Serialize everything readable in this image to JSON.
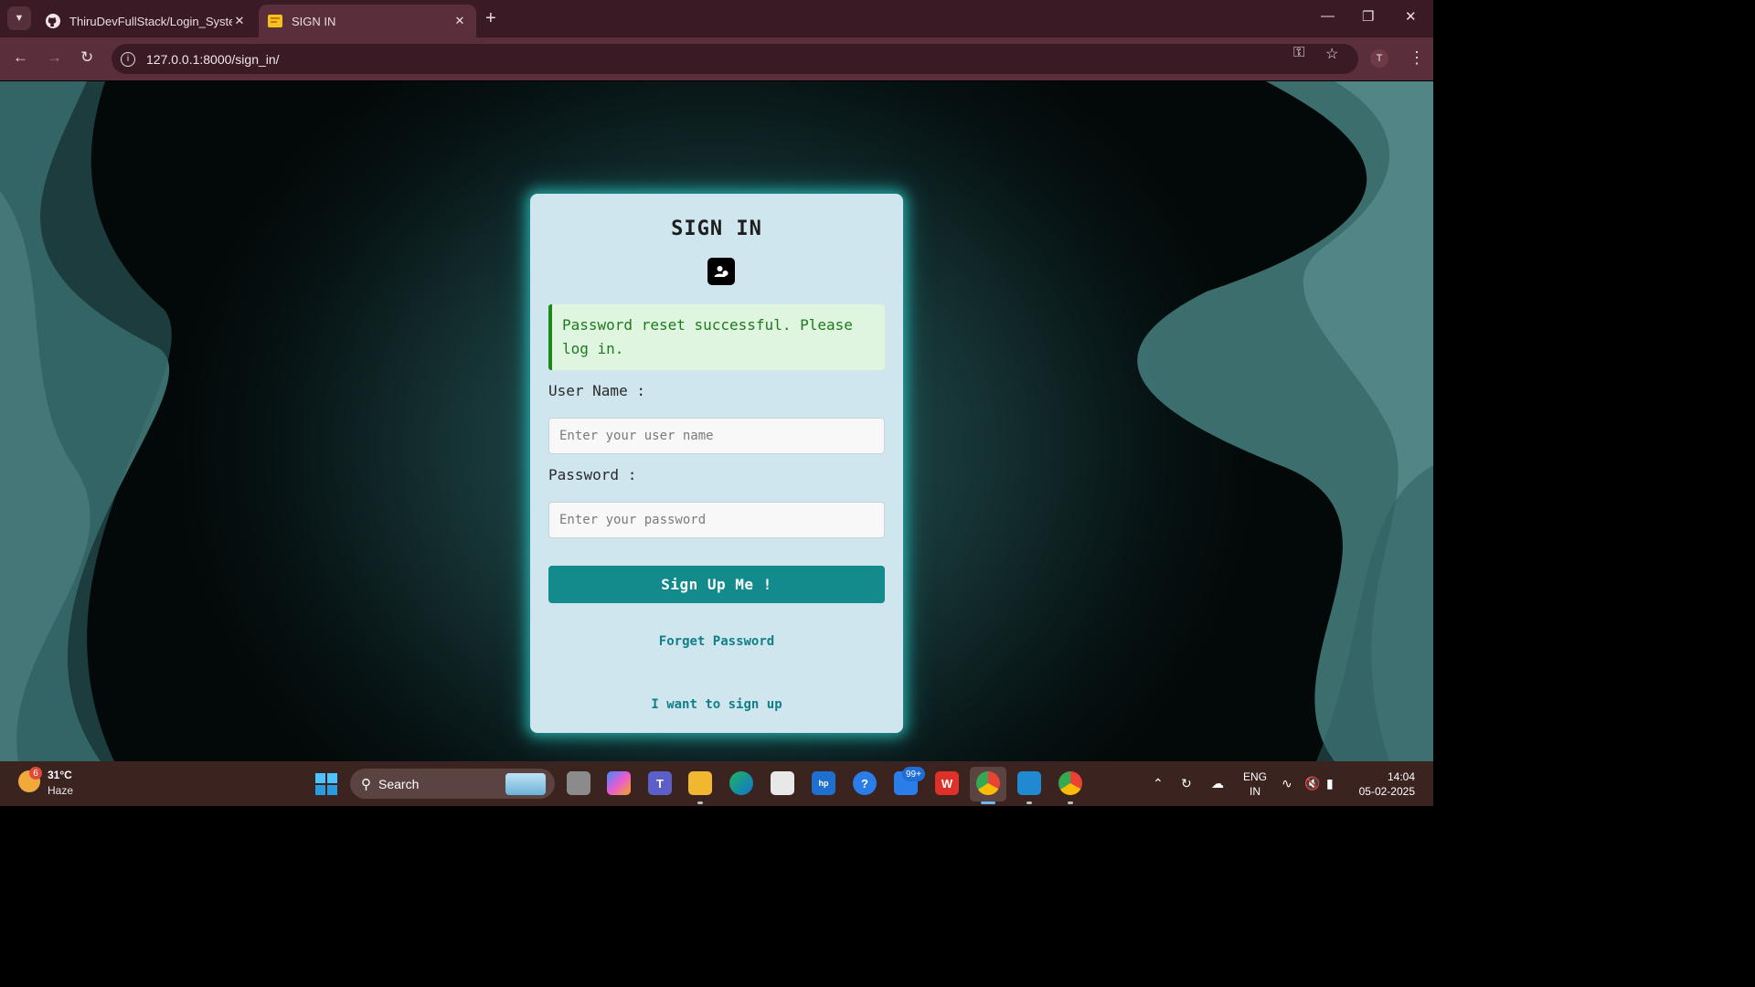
{
  "browser": {
    "tabs": [
      {
        "title": "ThiruDevFullStack/Login_System",
        "icon": "github-icon",
        "active": false
      },
      {
        "title": "SIGN IN",
        "icon": "site-favicon",
        "active": true
      }
    ],
    "url": "127.0.0.1:8000/sign_in/",
    "profile_initial": "T"
  },
  "page": {
    "title": "SIGN IN",
    "icon": "user-contact-icon",
    "alert": {
      "text": "Password reset successful. Please log in.",
      "type": "success",
      "color": "#1e7a1e"
    },
    "username": {
      "label": "User Name :",
      "placeholder": "Enter your user name",
      "value": ""
    },
    "password": {
      "label": "Password :",
      "placeholder": "Enter your password",
      "value": ""
    },
    "submit_label": "Sign Up Me !",
    "forgot_link": "Forget Password",
    "signup_link": "I want to sign up",
    "accent_color": "#138a8c"
  },
  "taskbar": {
    "weather": {
      "temp": "31°C",
      "condition": "Haze",
      "badge": "6"
    },
    "search_label": "Search",
    "notification_badge": "99+",
    "language": {
      "line1": "ENG",
      "line2": "IN"
    },
    "time": "14:04",
    "date": "05-02-2025"
  }
}
